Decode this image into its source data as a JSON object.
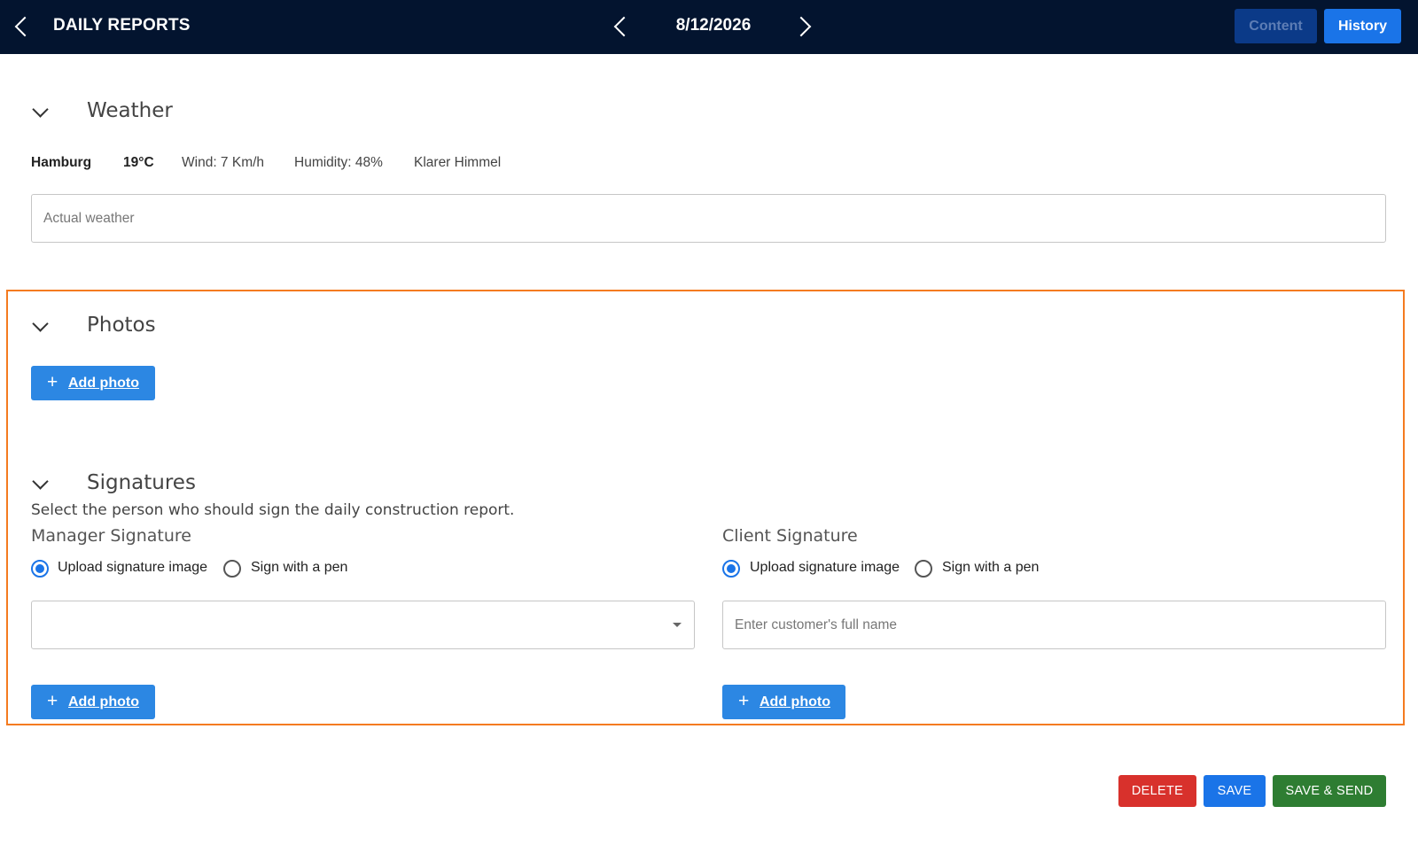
{
  "header": {
    "back_icon": "chevron-left-icon",
    "title": "DAILY REPORTS",
    "date": "8/12/2026",
    "prev_icon": "chevron-left-icon",
    "next_icon": "chevron-right-icon",
    "tabs": [
      {
        "label": "Content",
        "active": false
      },
      {
        "label": "History",
        "active": true
      }
    ]
  },
  "weather": {
    "title": "Weather",
    "city": "Hamburg",
    "temperature": "19°C",
    "wind": "Wind: 7 Km/h",
    "humidity": "Humidity: 48%",
    "condition": "Klarer Himmel",
    "actual_weather_placeholder": "Actual weather"
  },
  "photos": {
    "title": "Photos",
    "add_photo_label": "Add photo"
  },
  "signatures": {
    "title": "Signatures",
    "description": "Select the person who should sign the daily construction report.",
    "manager": {
      "title": "Manager Signature",
      "options": [
        "Upload signature image",
        "Sign with a pen"
      ],
      "selected": "Upload signature image",
      "select_value": "",
      "add_photo_label": "Add photo"
    },
    "client": {
      "title": "Client Signature",
      "options": [
        "Upload signature image",
        "Sign with a pen"
      ],
      "selected": "Upload signature image",
      "name_placeholder": "Enter customer's full name",
      "add_photo_label": "Add photo"
    }
  },
  "actions": {
    "delete": "DELETE",
    "save": "SAVE",
    "save_send": "SAVE & SEND"
  },
  "colors": {
    "header_bg": "#03142f",
    "primary": "#1a74e8",
    "highlight_border": "#f47b20",
    "delete": "#d8312c",
    "save_send": "#2e7d32"
  }
}
